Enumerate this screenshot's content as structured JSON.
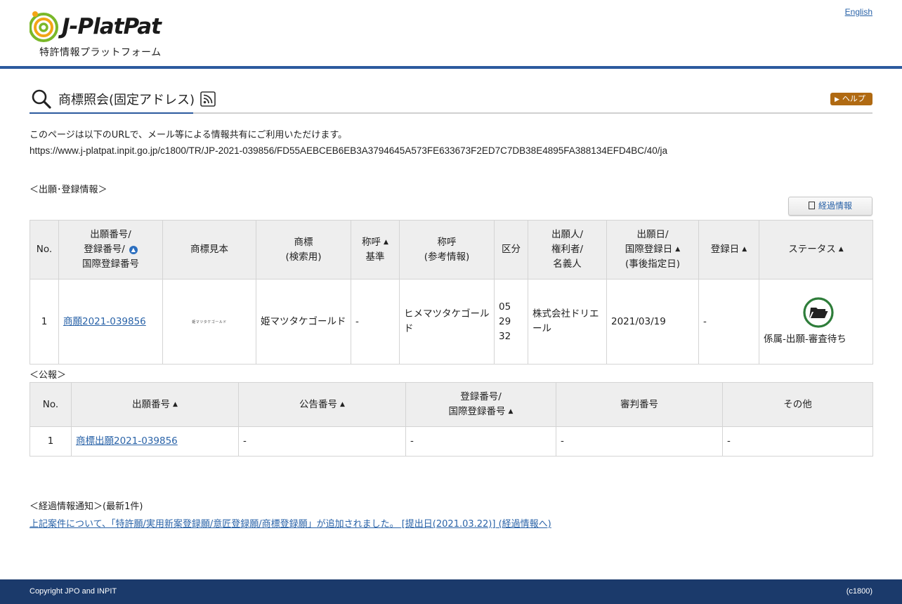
{
  "header": {
    "logo_text": "J-PlatPat",
    "logo_sub": "特許情報プラットフォーム",
    "lang_link": "English"
  },
  "title": {
    "text": "商標照会(固定アドレス)",
    "help_label": "ヘルプ"
  },
  "info": {
    "text": "このページは以下のURLで、メール等による情報共有にご利用いただけます。",
    "url": "https://www.j-platpat.inpit.go.jp/c1800/TR/JP-2021-039856/FD55AEBCEB6EB3A3794645A573FE633673F2ED7C7DB38E4895FA388134EFD4BC/40/ja"
  },
  "section1": {
    "label": "＜出願･登録情報＞",
    "keika_button": "経過情報",
    "headers": {
      "no": "No.",
      "app_no_1": "出願番号/",
      "app_no_2": "登録番号/",
      "app_no_3": "国際登録番号",
      "sample": "商標見本",
      "mark_1": "商標",
      "mark_2": "(検索用)",
      "yomi_base_1": "称呼",
      "yomi_base_2": "基準",
      "yomi_ref_1": "称呼",
      "yomi_ref_2": "(参考情報)",
      "class": "区分",
      "applicant_1": "出願人/",
      "applicant_2": "権利者/",
      "applicant_3": "名義人",
      "date_1": "出願日/",
      "date_2": "国際登録日",
      "date_3": "(事後指定日)",
      "reg_date": "登録日",
      "status": "ステータス"
    },
    "rows": [
      {
        "no": "1",
        "app_no": "商願2021-039856",
        "sample_text": "姫マツタケゴールド",
        "mark": "姫マツタケゴールド",
        "yomi_base": "-",
        "yomi_ref": "ヒメマツタケゴールド",
        "class_1": "05",
        "class_2": "29",
        "class_3": "32",
        "applicant": "株式会社ドリエール",
        "date": "2021/03/19",
        "reg_date": "-",
        "status": "係属-出願-審査待ち"
      }
    ]
  },
  "section2": {
    "label": "＜公報＞",
    "headers": {
      "no": "No.",
      "app_no": "出願番号",
      "pub_no": "公告番号",
      "reg_no_1": "登録番号/",
      "reg_no_2": "国際登録番号",
      "trial_no": "審判番号",
      "other": "その他"
    },
    "rows": [
      {
        "no": "1",
        "app_no": "商標出願2021-039856",
        "pub_no": "-",
        "reg_no": "-",
        "trial_no": "-",
        "other": "-"
      }
    ]
  },
  "notice": {
    "label": "＜経過情報通知＞(最新1件)",
    "link": "上記案件について、「特許願/実用新案登録願/意匠登録願/商標登録願」が追加されました。 [提出日(2021.03.22)] (経過情報へ)"
  },
  "footer": {
    "copyright": "Copyright JPO and INPIT",
    "page_code": "(c1800)"
  },
  "colors": {
    "brand_blue": "#2c5a9e",
    "footer_navy": "#1b3a6b",
    "help_orange": "#b06a12",
    "link_blue": "#2a63a8",
    "status_green": "#2e7d3a"
  }
}
